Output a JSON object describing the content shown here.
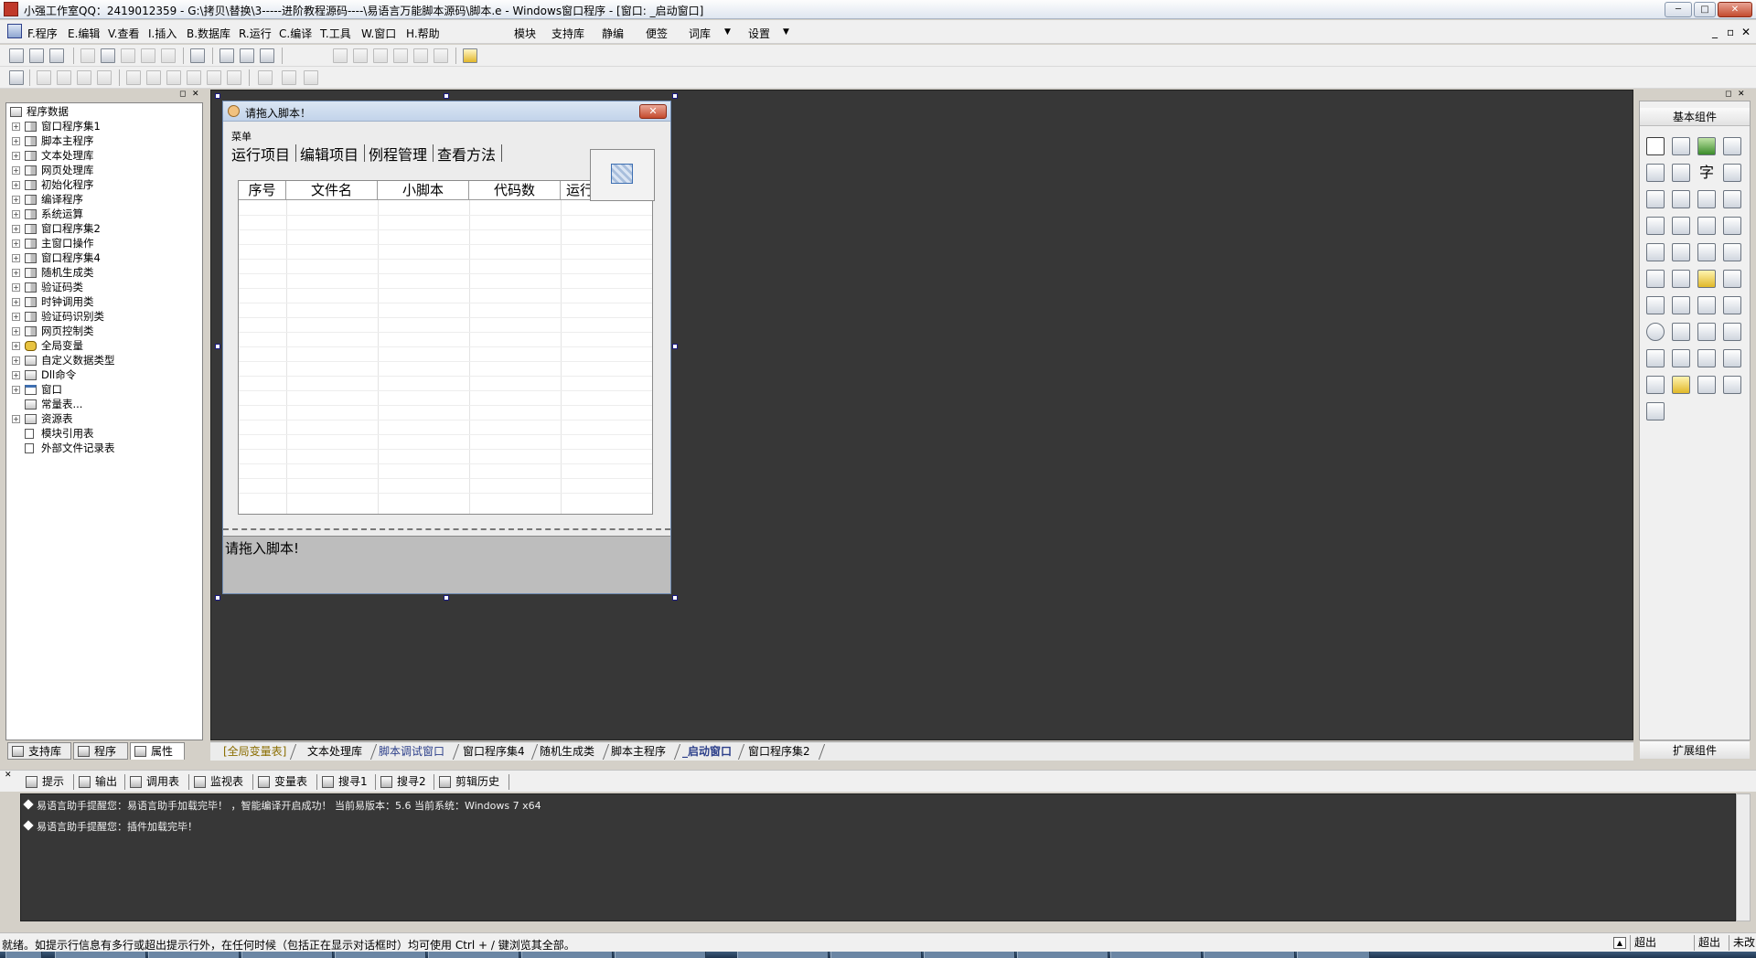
{
  "titlebar": {
    "title": "小强工作室QQ：2419012359 - G:\\拷贝\\替换\\3-----进阶教程源码----\\易语言万能脚本源码\\脚本.e - Windows窗口程序 - [窗口: _启动窗口]",
    "minimize": "─",
    "maximize": "□",
    "close": "✕"
  },
  "menubar": {
    "items": [
      "F.程序",
      "E.编辑",
      "V.查看",
      "I.插入",
      "B.数据库",
      "R.运行",
      "C.编译",
      "T.工具",
      "W.窗口",
      "H.帮助"
    ],
    "extra": [
      "模块",
      "支持库",
      "静编",
      "便签",
      "词库",
      "设置"
    ],
    "dropdown": "▼",
    "mdi_controls": [
      "_",
      "▫",
      "✕"
    ]
  },
  "leftpanel": {
    "header_controls": [
      "◻",
      "✕"
    ],
    "root": "程序数据",
    "items": [
      {
        "label": "窗口程序集1",
        "icon": "book"
      },
      {
        "label": "脚本主程序",
        "icon": "book"
      },
      {
        "label": "文本处理库",
        "icon": "book"
      },
      {
        "label": "网页处理库",
        "icon": "book"
      },
      {
        "label": "初始化程序",
        "icon": "book"
      },
      {
        "label": "编译程序",
        "icon": "book"
      },
      {
        "label": "系统运算",
        "icon": "book"
      },
      {
        "label": "窗口程序集2",
        "icon": "book"
      },
      {
        "label": "主窗口操作",
        "icon": "book"
      },
      {
        "label": "窗口程序集4",
        "icon": "book"
      },
      {
        "label": "随机生成类",
        "icon": "book"
      },
      {
        "label": "验证码类",
        "icon": "book"
      },
      {
        "label": "时钟调用类",
        "icon": "book"
      },
      {
        "label": "验证码识别类",
        "icon": "book"
      },
      {
        "label": "网页控制类",
        "icon": "book"
      },
      {
        "label": "全局变量",
        "icon": "db"
      },
      {
        "label": "自定义数据类型",
        "icon": "table"
      },
      {
        "label": "Dll命令",
        "icon": "table"
      },
      {
        "label": "窗口",
        "icon": "win"
      },
      {
        "label": "常量表...",
        "icon": "table"
      },
      {
        "label": "资源表",
        "icon": "table"
      },
      {
        "label": "模块引用表",
        "icon": "doc"
      },
      {
        "label": "外部文件记录表",
        "icon": "doc"
      }
    ],
    "tabs": [
      "支持库",
      "程序",
      "属性"
    ]
  },
  "designwindow": {
    "title": "请拖入脚本！",
    "close": "✕",
    "menu_label": "菜单",
    "tabs": [
      "运行项目",
      "编辑项目",
      "例程管理",
      "查看方法"
    ],
    "columns": [
      "序号",
      "文件名",
      "小脚本",
      "代码数",
      "运行"
    ],
    "bottom_text": "请拖入脚本!"
  },
  "rightpanel": {
    "header_controls": [
      "◻",
      "✕"
    ],
    "title": "基本组件",
    "bottom_title": "扩展组件",
    "text_glyph": "字"
  },
  "doc_tabs": [
    "[全局变量表]",
    "文本处理库",
    "脚本调试窗口",
    "窗口程序集4",
    "随机生成类",
    "脚本主程序",
    "_启动窗口",
    "窗口程序集2"
  ],
  "output_tabs": [
    "提示",
    "输出",
    "调用表",
    "监视表",
    "变量表",
    "搜寻1",
    "搜寻2",
    "剪辑历史"
  ],
  "output_lines": [
    "易语言助手提醒您：易语言助手加载完毕！ ，智能编译开启成功！ 当前易版本：5.6  当前系统：Windows 7 x64",
    "易语言助手提醒您：插件加载完毕！"
  ],
  "statusbar": {
    "text": "就绪。如提示行信息有多行或超出提示行外，在任何时候（包括正在显示对话框时）均可使用 Ctrl + / 键浏览其全部。",
    "cells": [
      "超出",
      "超出",
      "未改"
    ]
  },
  "colors": {
    "workspace": "#373737",
    "accent": "#3d6fb2",
    "close_red": "#c44a2e"
  }
}
